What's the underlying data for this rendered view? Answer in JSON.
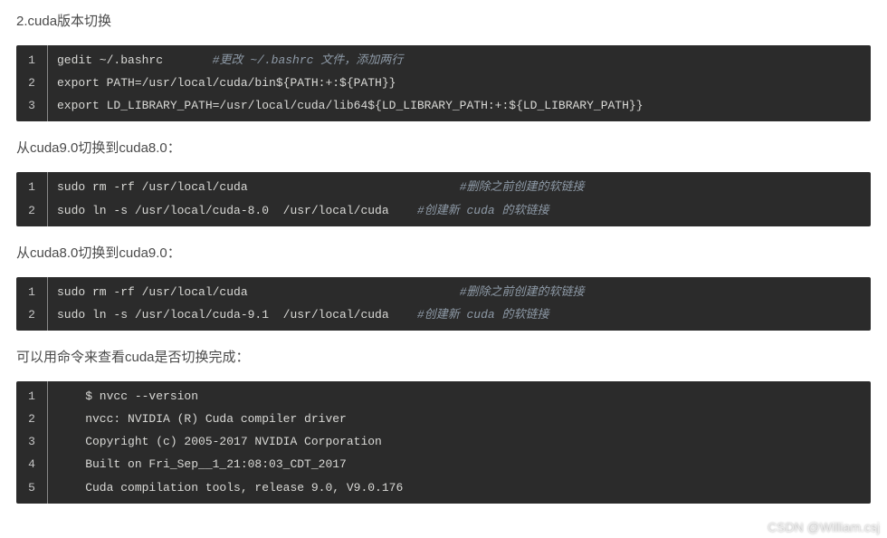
{
  "paragraphs": {
    "p1": "2.cuda版本切换",
    "p2": "从cuda9.0切换到cuda8.0：",
    "p3": "从cuda8.0切换到cuda9.0：",
    "p4": "可以用命令来查看cuda是否切换完成："
  },
  "code1": {
    "l1_cmd": "gedit ~/.bashrc",
    "l1_cmt": "#更改 ~/.bashrc 文件，添加两行",
    "l2": "export PATH=/usr/local/cuda/bin${PATH:+:${PATH}}",
    "l3": "export LD_LIBRARY_PATH=/usr/local/cuda/lib64${LD_LIBRARY_PATH:+:${LD_LIBRARY_PATH}}"
  },
  "code2": {
    "l1_cmd": "sudo rm -rf /usr/local/cuda",
    "l1_cmt": "#删除之前创建的软链接",
    "l2_cmd": "sudo ln -s /usr/local/cuda-8.0  /usr/local/cuda",
    "l2_cmt": "#创建新 cuda 的软链接"
  },
  "code3": {
    "l1_cmd": "sudo rm -rf /usr/local/cuda",
    "l1_cmt": "#删除之前创建的软链接",
    "l2_cmd": "sudo ln -s /usr/local/cuda-9.1  /usr/local/cuda",
    "l2_cmt": "#创建新 cuda 的软链接"
  },
  "code4": {
    "l1": "    $ nvcc --version",
    "l2": "    nvcc: NVIDIA (R) Cuda compiler driver",
    "l3": "    Copyright (c) 2005-2017 NVIDIA Corporation",
    "l4": "    Built on Fri_Sep__1_21:08:03_CDT_2017",
    "l5": "    Cuda compilation tools, release 9.0, V9.0.176"
  },
  "linenums": {
    "n1": "1",
    "n2": "2",
    "n3": "3",
    "n4": "4",
    "n5": "5"
  },
  "watermark": "CSDN @William.csj"
}
